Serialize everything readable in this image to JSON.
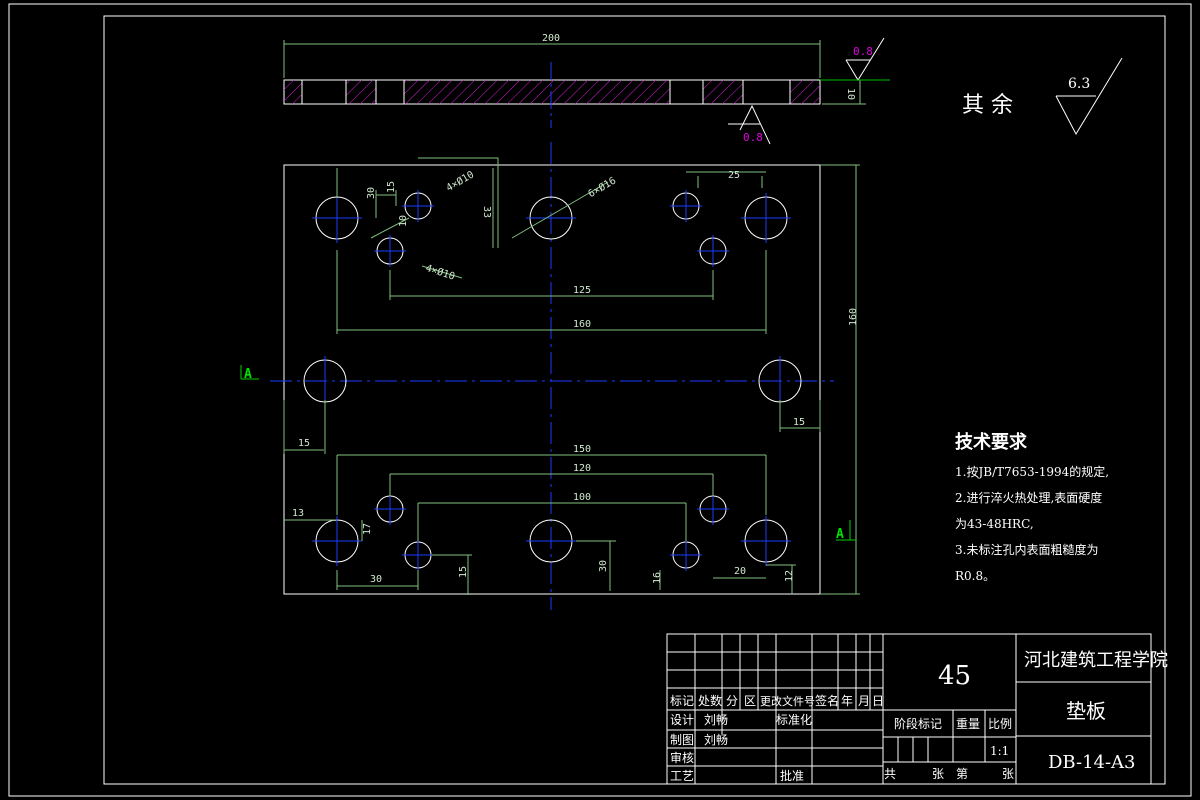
{
  "roughness": {
    "general_label": "其 余",
    "general_value": "6.3",
    "top_value": "0.8",
    "bottom_value": "0.8"
  },
  "top_view": {
    "width_dim": "200",
    "thickness_dim": "10"
  },
  "plan_dims": {
    "d30_top": "30",
    "d15a": "15",
    "d10": "10",
    "d33": "33",
    "d25": "25",
    "d125": "125",
    "d160_top": "160",
    "d160_height": "160",
    "d15_left": "15",
    "d15_right": "15",
    "d150": "150",
    "d120": "120",
    "d100": "100",
    "d13": "13",
    "d17": "17",
    "d30_bot": "30",
    "d15_bot": "15",
    "d30_mid": "30",
    "d16": "16",
    "d20": "20",
    "d12": "12",
    "hole_6x10_a": "4×Ø10",
    "hole_6x16": "6×Ø16",
    "hole_4x10_b": "4×Ø10"
  },
  "section": {
    "left": "A",
    "right": "A"
  },
  "tech_requirements": {
    "title": "技术要求",
    "lines": [
      "1.按JB/T7653-1994的规定,",
      "2.进行淬火热处理,表面硬度",
      "为43-48HRC,",
      "3.未标注孔内表面粗糙度为",
      "R0.8。"
    ]
  },
  "title_block": {
    "material": "45",
    "school": "河北建筑工程学院",
    "part_name": "垫板",
    "drawing_no": "DB-14-A3",
    "headers": [
      "标记",
      "处数",
      "分",
      "区",
      "更改文件号",
      "签名",
      "年",
      "月",
      "日"
    ],
    "design_label": "设计",
    "design_name": "刘畅",
    "standardize_label": "标准化",
    "draw_label": "制图",
    "draw_name": "刘畅",
    "review_label": "审核",
    "process_label": "工艺",
    "approve_label": "批准",
    "stage_label": "阶段标记",
    "weight_label": "重量",
    "scale_label": "比例",
    "scale_value": "1:1",
    "total_label": "共",
    "sheet_label": "张",
    "page_label": "第",
    "page_sheet_label": "张"
  }
}
